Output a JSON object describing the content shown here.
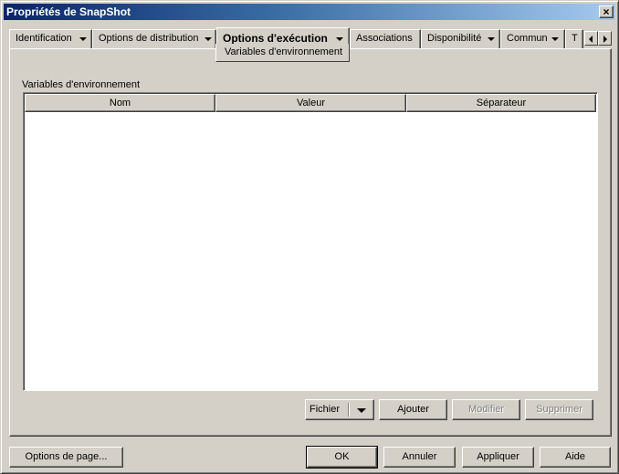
{
  "window": {
    "title": "Propriétés de SnapShot",
    "close": "×"
  },
  "tabs": [
    {
      "label": "Identification"
    },
    {
      "label": "Options de distribution"
    },
    {
      "label": "Options d'exécution"
    },
    {
      "label": "Associations"
    },
    {
      "label": "Disponibilité"
    },
    {
      "label": "Commun"
    },
    {
      "label": "T"
    }
  ],
  "submenu": {
    "active_item": "Variables d'environnement"
  },
  "section": {
    "label": "Variables d'environnement"
  },
  "listview": {
    "columns": [
      "Nom",
      "Valeur",
      "Séparateur"
    ],
    "rows": []
  },
  "list_buttons": {
    "file": "Fichier",
    "add": "Ajouter",
    "modify": "Modifier",
    "delete": "Supprimer"
  },
  "footer": {
    "page_options": "Options de page...",
    "ok": "OK",
    "cancel": "Annuler",
    "apply": "Appliquer",
    "help": "Aide"
  }
}
